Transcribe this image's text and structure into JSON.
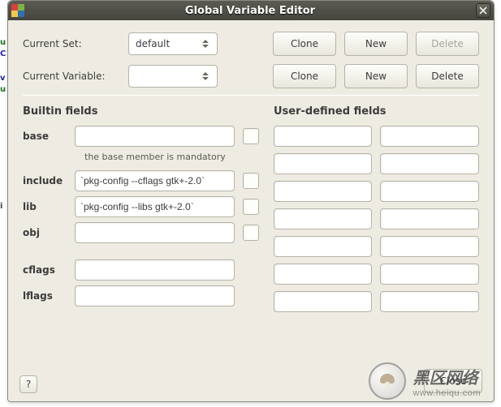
{
  "window": {
    "title": "Global Variable Editor"
  },
  "top": {
    "setLabel": "Current Set:",
    "setValue": "default",
    "varLabel": "Current Variable:",
    "varValue": "",
    "clone": "Clone",
    "new": "New",
    "delete": "Delete"
  },
  "builtin": {
    "header": "Builtin fields",
    "base": {
      "label": "base",
      "value": "",
      "note": "the base member is mandatory"
    },
    "include": {
      "label": "include",
      "value": "`pkg-config --cflags gtk+-2.0`"
    },
    "lib": {
      "label": "lib",
      "value": "`pkg-config --libs gtk+-2.0`"
    },
    "obj": {
      "label": "obj",
      "value": ""
    },
    "cflags": {
      "label": "cflags",
      "value": ""
    },
    "lflags": {
      "label": "lflags",
      "value": ""
    }
  },
  "userdef": {
    "header": "User-defined fields",
    "rows": [
      {
        "k": "",
        "v": ""
      },
      {
        "k": "",
        "v": ""
      },
      {
        "k": "",
        "v": ""
      },
      {
        "k": "",
        "v": ""
      },
      {
        "k": "",
        "v": ""
      },
      {
        "k": "",
        "v": ""
      },
      {
        "k": "",
        "v": ""
      }
    ]
  },
  "footer": {
    "help": "?",
    "close": "Close"
  },
  "watermark": {
    "l1": "黑区网络",
    "l2": "www.heiqu.com"
  }
}
